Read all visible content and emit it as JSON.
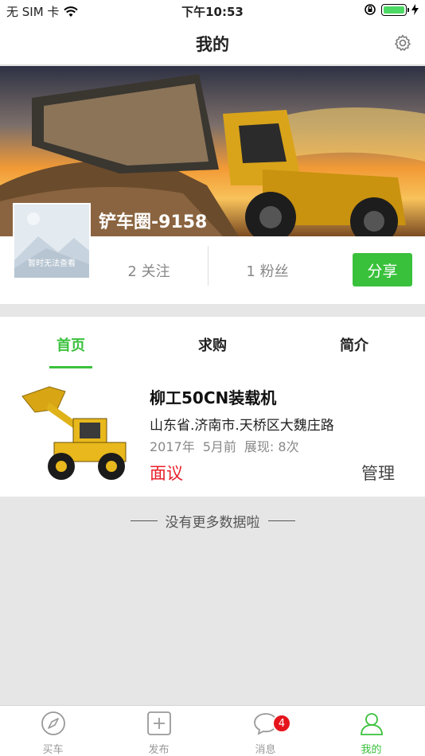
{
  "status_bar": {
    "carrier": "无 SIM 卡",
    "time": "下午10:53"
  },
  "header": {
    "title": "我的"
  },
  "profile": {
    "name": "铲车圈-9158",
    "avatar_placeholder": "暂时无法查看",
    "following": "2 关注",
    "followers": "1 粉丝",
    "share_label": "分享"
  },
  "tabs": [
    {
      "label": "首页",
      "active": true
    },
    {
      "label": "求购",
      "active": false
    },
    {
      "label": "简介",
      "active": false
    }
  ],
  "listing": {
    "title": "柳工50CN装载机",
    "address": "山东省.济南市.天桥区大魏庄路",
    "year": "2017年",
    "posted": "5月前",
    "views": "展现: 8次",
    "price": "面议",
    "manage_label": "管理"
  },
  "no_more_text": "没有更多数据啦",
  "tab_bar": {
    "items": [
      {
        "label": "买车",
        "icon": "compass-icon"
      },
      {
        "label": "发布",
        "icon": "plus-square-icon"
      },
      {
        "label": "消息",
        "icon": "chat-icon",
        "badge": "4"
      },
      {
        "label": "我的",
        "icon": "person-icon",
        "active": true
      }
    ]
  },
  "colors": {
    "accent": "#3ac13c",
    "price": "#e8202a",
    "badge": "#e5141c"
  }
}
